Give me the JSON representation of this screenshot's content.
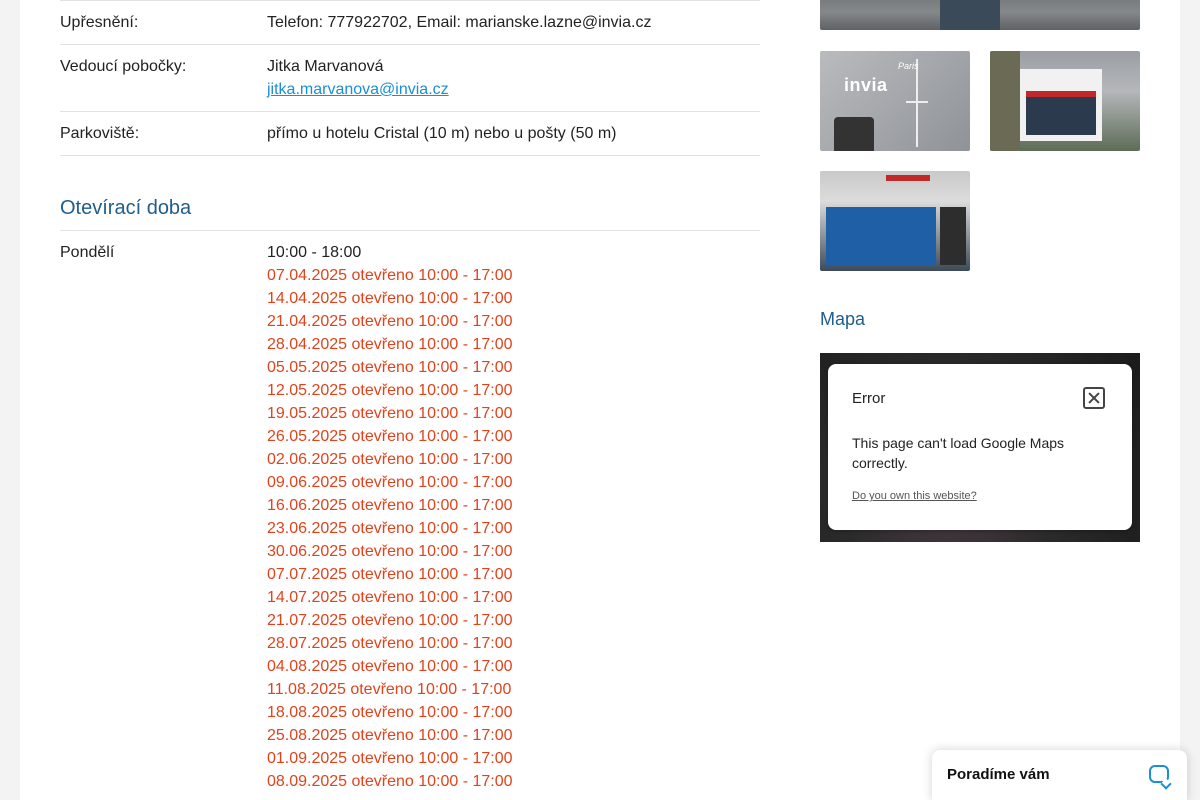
{
  "details": [
    {
      "label": "Upřesnění:",
      "value": "Telefon: 777922702, Email: marianske.lazne@invia.cz"
    },
    {
      "label": "Vedoucí pobočky:",
      "value": "Jitka Marvanová",
      "link": "jitka.marvanova@invia.cz"
    },
    {
      "label": "Parkoviště:",
      "value": "přímo u hotelu Cristal (10 m) nebo u pošty (50 m)"
    }
  ],
  "hours": {
    "title": "Otevírací doba",
    "day": "Pondělí",
    "regular": "10:00 - 18:00",
    "exceptions": [
      "07.04.2025 otevřeno 10:00 - 17:00",
      "14.04.2025 otevřeno 10:00 - 17:00",
      "21.04.2025 otevřeno 10:00 - 17:00",
      "28.04.2025 otevřeno 10:00 - 17:00",
      "05.05.2025 otevřeno 10:00 - 17:00",
      "12.05.2025 otevřeno 10:00 - 17:00",
      "19.05.2025 otevřeno 10:00 - 17:00",
      "26.05.2025 otevřeno 10:00 - 17:00",
      "02.06.2025 otevřeno 10:00 - 17:00",
      "09.06.2025 otevřeno 10:00 - 17:00",
      "16.06.2025 otevřeno 10:00 - 17:00",
      "23.06.2025 otevřeno 10:00 - 17:00",
      "30.06.2025 otevřeno 10:00 - 17:00",
      "07.07.2025 otevřeno 10:00 - 17:00",
      "14.07.2025 otevřeno 10:00 - 17:00",
      "21.07.2025 otevřeno 10:00 - 17:00",
      "28.07.2025 otevřeno 10:00 - 17:00",
      "04.08.2025 otevřeno 10:00 - 17:00",
      "11.08.2025 otevřeno 10:00 - 17:00",
      "18.08.2025 otevřeno 10:00 - 17:00",
      "25.08.2025 otevřeno 10:00 - 17:00",
      "01.09.2025 otevřeno 10:00 - 17:00",
      "08.09.2025 otevřeno 10:00 - 17:00"
    ]
  },
  "gallery": {
    "photo1_logo": "invia",
    "photo1_script": "Paris"
  },
  "map": {
    "title": "Mapa",
    "error_title": "Error",
    "error_message": "This page can't load Google Maps correctly.",
    "error_link": "Do you own this website?"
  },
  "chat": {
    "label": "Poradíme vám",
    "icon": "chat-bubble-icon"
  },
  "colors": {
    "accent": "#1f5d8c",
    "link": "#1a8fd2",
    "exception": "#e0431b"
  }
}
